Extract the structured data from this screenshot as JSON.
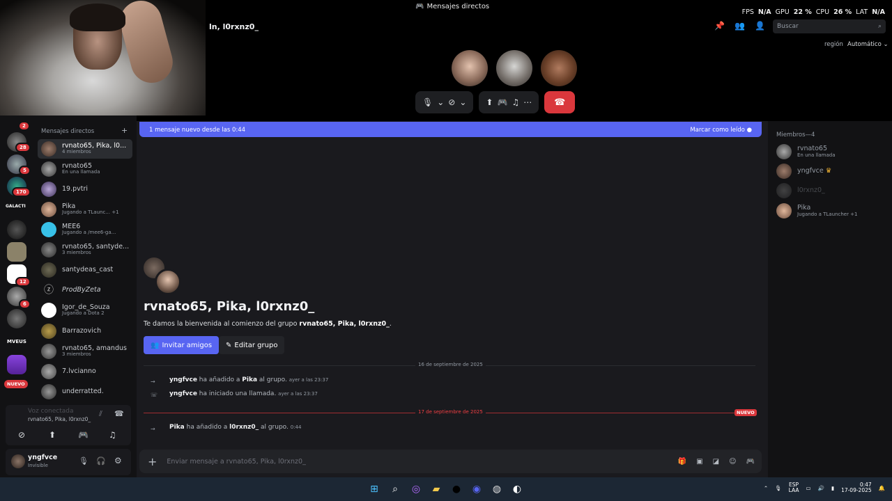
{
  "window": {
    "title": "Mensajes directos"
  },
  "perf": {
    "fps_label": "FPS",
    "fps": "N/A",
    "gpu_label": "GPU",
    "gpu": "22 %",
    "cpu_label": "CPU",
    "cpu": "26 %",
    "lat_label": "LAT",
    "lat": "N/A"
  },
  "call": {
    "header_name": "ln, l0rxnz0_",
    "region_label": "región",
    "region_value": "Automático"
  },
  "search": {
    "placeholder": "Buscar"
  },
  "guild_badges": [
    "2",
    "28",
    "5",
    "170",
    "12",
    "6"
  ],
  "guild_labels": {
    "galactic": "GALACTI",
    "mveus": "MVEUS",
    "new": "NUEVO"
  },
  "dm": {
    "header": "Mensajes directos",
    "items": [
      {
        "name": "rvnato65, Pika, l0...",
        "sub": "4 miembros"
      },
      {
        "name": "rvnato65",
        "sub": "En una llamada"
      },
      {
        "name": "19.pvtri",
        "sub": ""
      },
      {
        "name": "Pika",
        "sub": "Jugando a TLaunc... +1"
      },
      {
        "name": "MEE6",
        "sub": "Jugando a /mee6-ga..."
      },
      {
        "name": "rvnato65, santyde...",
        "sub": "3 miembros"
      },
      {
        "name": "santydeas_cast",
        "sub": ""
      },
      {
        "name": "ProdByZeta",
        "sub": ""
      },
      {
        "name": "Igor_de_Souza",
        "sub": "Jugando a Dota 2"
      },
      {
        "name": "Barrazovich",
        "sub": ""
      },
      {
        "name": "rvnato65, amandus",
        "sub": "3 miembros"
      },
      {
        "name": "7.lvcianno",
        "sub": ""
      },
      {
        "name": "underratted.",
        "sub": ""
      }
    ]
  },
  "voice": {
    "status": "Voz conectada",
    "channel": "rvnato65, Pika, l0rxnz0_"
  },
  "user": {
    "name": "yngfvce",
    "status": "Invisible"
  },
  "banner": {
    "text": "1 mensaje nuevo desde las 0:44",
    "action": "Marcar como leído"
  },
  "group": {
    "title": "rvnato65, Pika, l0rxnz0_",
    "welcome_prefix": "Te damos la bienvenida al comienzo del grupo ",
    "welcome_name": "rvnato65, Pika, l0rxnz0_",
    "welcome_suffix": ".",
    "invite": "Invitar amigos",
    "edit": "Editar grupo"
  },
  "messages": {
    "date1": "16 de septiembre de 2025",
    "m1_user": "yngfvce",
    "m1_mid": " ha añadido a ",
    "m1_target": "Pika",
    "m1_end": " al grupo. ",
    "m1_time": "ayer a las 23:37",
    "m2_user": "yngfvce",
    "m2_mid": " ha iniciado una llamada. ",
    "m2_time": "ayer a las 23:37",
    "date2": "17 de septiembre de 2025",
    "new_badge": "NUEVO",
    "m3_user": "Pika",
    "m3_mid": " ha añadido a ",
    "m3_target": "l0rxnz0_",
    "m3_end": " al grupo. ",
    "m3_time": "0:44"
  },
  "composer": {
    "placeholder": "Enviar mensaje a rvnato65, Pika, l0rxnz0_"
  },
  "members": {
    "header": "Miembros—4",
    "items": [
      {
        "name": "rvnato65",
        "sub": "En una llamada"
      },
      {
        "name": "yngfvce",
        "sub": ""
      },
      {
        "name": "l0rxnz0_",
        "sub": ""
      },
      {
        "name": "Pika",
        "sub": "Jugando a TLauncher +1"
      }
    ]
  },
  "tray": {
    "lang": "ESP",
    "layout": "LAA",
    "time": "0:47",
    "date": "17-09-2025"
  },
  "colors": {
    "blurple": "#5865f2",
    "red": "#da373c",
    "bg": "#1a1a1e"
  }
}
